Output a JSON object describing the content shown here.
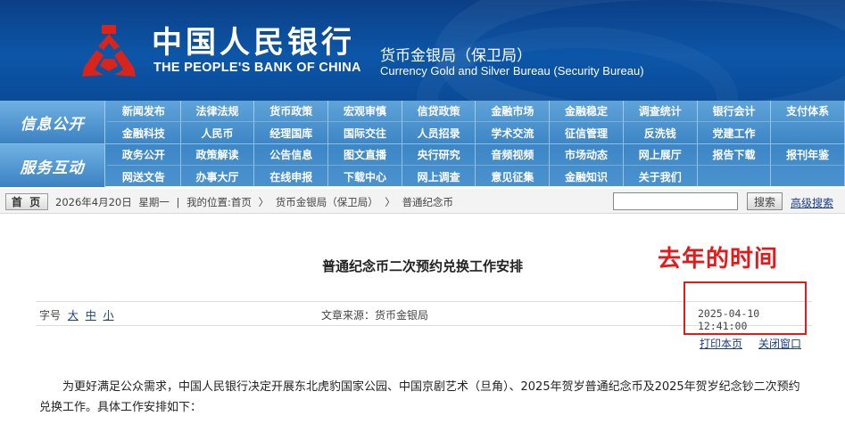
{
  "header": {
    "brand_cn": "中国人民银行",
    "brand_en": "THE PEOPLE'S BANK OF CHINA",
    "bureau_cn": "货币金银局（保卫局）",
    "bureau_en": "Currency  Gold and Silver Bureau (Security Bureau)",
    "logo_color": "#d9241b"
  },
  "nav": {
    "group1_label": "信息公开",
    "group1_items": [
      "新闻发布",
      "法律法规",
      "货币政策",
      "宏观审慎",
      "信贷政策",
      "金融市场",
      "金融稳定",
      "调查统计",
      "银行会计",
      "支付体系",
      "金融科技",
      "人民币",
      "经理国库",
      "国际交往",
      "人员招录",
      "学术交流",
      "征信管理",
      "反洗钱",
      "党建工作",
      ""
    ],
    "group2_label": "服务互动",
    "group2_items": [
      "政务公开",
      "政策解读",
      "公告信息",
      "图文直播",
      "央行研究",
      "音频视频",
      "市场动态",
      "网上展厅",
      "报告下载",
      "报刊年鉴",
      "网送文告",
      "办事大厅",
      "在线申报",
      "下载中心",
      "网上调查",
      "意见征集",
      "金融知识",
      "关于我们",
      "",
      ""
    ]
  },
  "location": {
    "home": "首 页",
    "date": "2026年4月20日",
    "weekday": "星期一",
    "sep": "|",
    "position_label": "我的位置:首页",
    "arrow": "〉",
    "crumb1": "货币金银局（保卫局）",
    "crumb2": "普通纪念币",
    "search_btn": "搜索",
    "advanced": "高级搜索"
  },
  "article": {
    "title": "普通纪念币二次预约兑换工作安排",
    "annotation": "去年的时间",
    "font_label": "字号",
    "font_large": "大",
    "font_mid": "中",
    "font_small": "小",
    "source": "文章来源：货币金银局",
    "datetime": "2025-04-10 12:41:00",
    "print": "打印本页",
    "close": "关闭窗口",
    "paragraph": "为更好满足公众需求，中国人民银行决定开展东北虎豹国家公园、中国京剧艺术（旦角）、2025年贺岁普通纪念币及2025年贺岁纪念钞二次预约兑换工作。具体工作安排如下："
  }
}
